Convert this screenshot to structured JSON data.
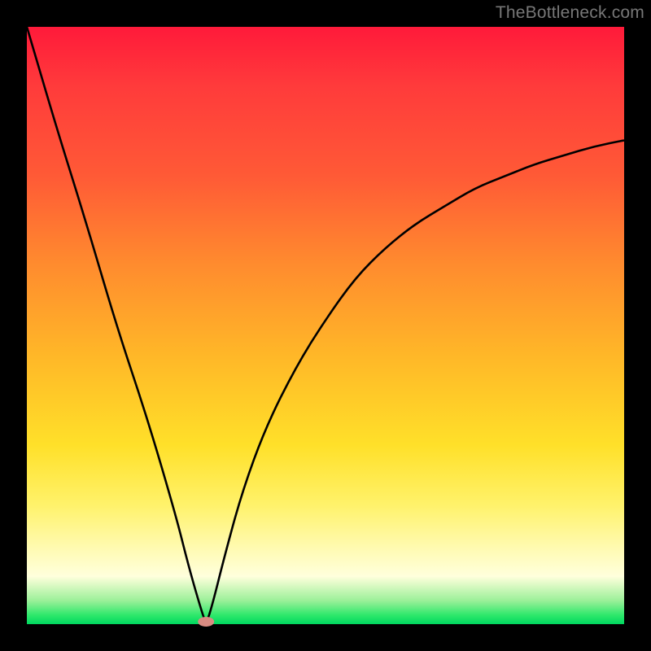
{
  "watermark": "TheBottleneck.com",
  "chart_data": {
    "type": "line",
    "title": "",
    "xlabel": "",
    "ylabel": "",
    "xlim": [
      0,
      100
    ],
    "ylim": [
      0,
      100
    ],
    "grid": false,
    "legend": false,
    "series": [
      {
        "name": "curve",
        "x": [
          0,
          5,
          10,
          15,
          20,
          25,
          27,
          29,
          30,
          31,
          33,
          36,
          40,
          45,
          50,
          55,
          60,
          65,
          70,
          75,
          80,
          85,
          90,
          95,
          100
        ],
        "values": [
          100,
          83,
          67,
          50,
          35,
          18,
          10,
          3,
          0,
          3,
          11,
          22,
          33,
          43,
          51,
          58,
          63,
          67,
          70,
          73,
          75,
          77,
          78.5,
          80,
          81
        ]
      }
    ],
    "marker": {
      "x": 30,
      "y": 0,
      "color": "#d98b82",
      "rx": 10,
      "ry": 6
    },
    "background_gradient": {
      "stops": [
        {
          "pos": 0.0,
          "color": "#ff1a3a"
        },
        {
          "pos": 0.4,
          "color": "#ff8c2e"
        },
        {
          "pos": 0.7,
          "color": "#ffe029"
        },
        {
          "pos": 0.92,
          "color": "#ffffdc"
        },
        {
          "pos": 1.0,
          "color": "#00d85f"
        }
      ]
    }
  }
}
